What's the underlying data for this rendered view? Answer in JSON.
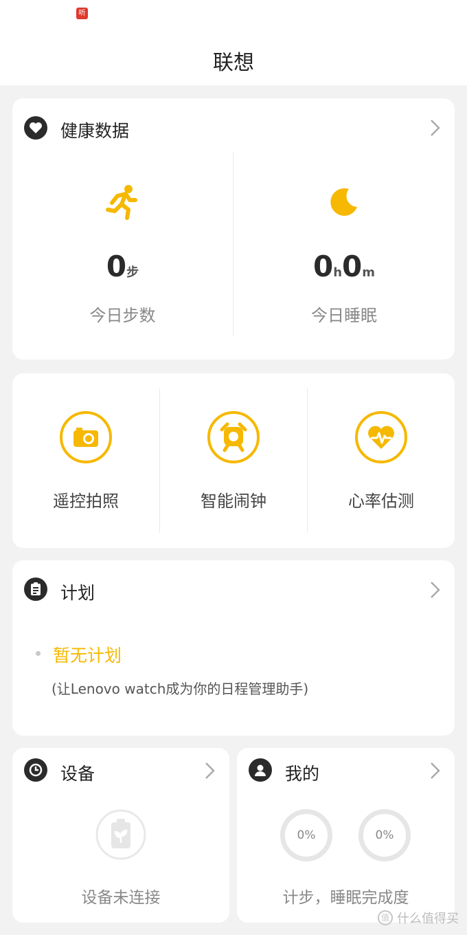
{
  "status_bar": {
    "badge": "听"
  },
  "header": {
    "title": "联想"
  },
  "health": {
    "title": "健康数据",
    "steps": {
      "value": "0",
      "unit": "步",
      "label": "今日步数"
    },
    "sleep": {
      "hours": "0",
      "hours_unit": "h",
      "minutes": "0",
      "minutes_unit": "m",
      "label": "今日睡眠"
    }
  },
  "tools": [
    {
      "label": "遥控拍照",
      "icon": "camera-icon"
    },
    {
      "label": "智能闹钟",
      "icon": "alarm-clock-icon"
    },
    {
      "label": "心率估测",
      "icon": "heart-rate-icon"
    }
  ],
  "plan": {
    "title": "计划",
    "empty_text": "暂无计划",
    "hint": "(让Lenovo watch成为你的日程管理助手)"
  },
  "device": {
    "title": "设备",
    "status": "设备未连接"
  },
  "mine": {
    "title": "我的",
    "step_percent": "0%",
    "sleep_percent": "0%",
    "caption": "计步，睡眠完成度"
  },
  "watermark": {
    "text": "什么值得买",
    "logo_char": "值"
  },
  "colors": {
    "accent": "#f6b800",
    "dark_icon": "#2b2b2b",
    "background": "#f2f2f2",
    "badge": "#e03a2f"
  }
}
